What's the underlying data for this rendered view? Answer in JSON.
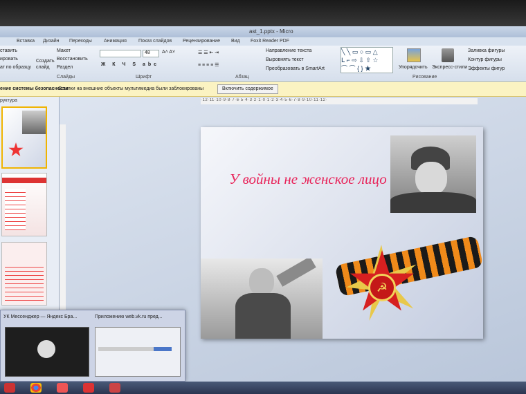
{
  "window": {
    "title": "ast_1.pptx - Micro"
  },
  "tabs": [
    "Вставка",
    "Дизайн",
    "Переходы",
    "Анимация",
    "Показ слайдов",
    "Рецензирование",
    "Вид",
    "Foxit Reader PDF"
  ],
  "ribbon": {
    "left_labels": [
      "ставить",
      "ировать",
      "ат по образцу"
    ],
    "create_slide": "Создать слайд",
    "layout": "Макет",
    "restore": "Восстановить",
    "section": "Раздел",
    "font_size": "48",
    "text_direction": "Направление текста",
    "align_text": "Выровнять текст",
    "convert_smartart": "Преобразовать в SmartArt",
    "arrange": "Упорядочить",
    "quick_styles": "Экспресс-стили",
    "shape_fill": "Заливка фигуры",
    "shape_outline": "Контур фигуры",
    "shape_effects": "Эффекты фигур",
    "groups": {
      "slides": "Слайды",
      "font": "Шрифт",
      "paragraph": "Абзац",
      "drawing": "Рисование"
    }
  },
  "security_bar": {
    "title": "ение системы безопасности",
    "message": "Ссылки на внешние объекты мультимедиа были заблокированы",
    "button": "Включить содержимое"
  },
  "panel": {
    "tab_label": "руктура"
  },
  "ruler": {
    "marks": "·12·11·10·9·8·7·6·5·4·3·2·1·0·1·2·3·4·5·6·7·8·9·10·11·12·"
  },
  "slide": {
    "title": "У войны не женское лицо"
  },
  "taskbar_popup": {
    "item1": "УК Мессенджер — Яндекс Бра...",
    "item2": "Приложению web.vk.ru пред..."
  },
  "colors": {
    "title_pink": "#e8245a",
    "security_bar": "#fbf3c2",
    "ribbon": "#d6dfec"
  }
}
